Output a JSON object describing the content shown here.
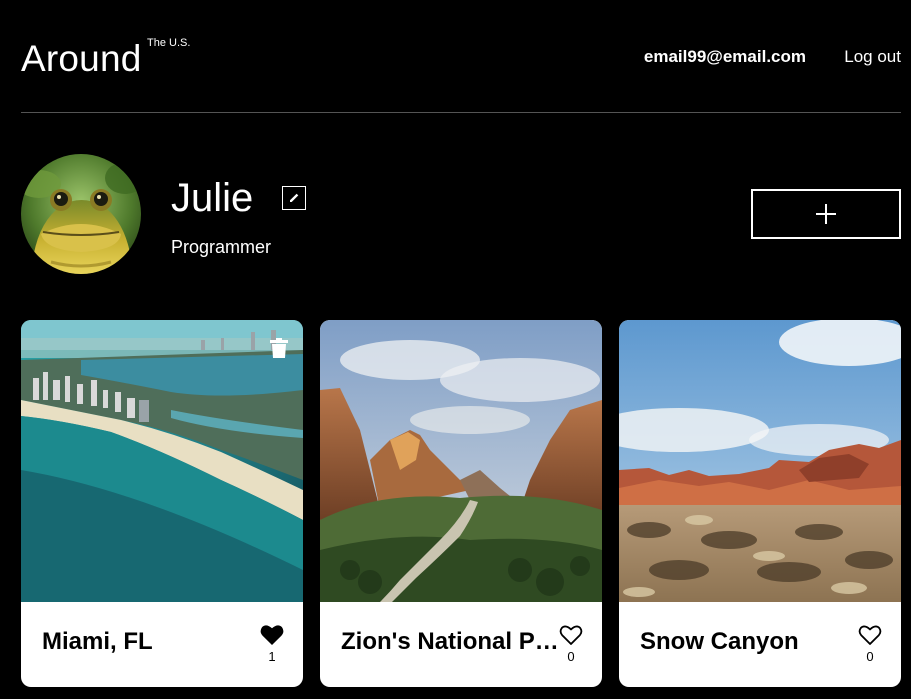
{
  "header": {
    "logo": "Around",
    "logo_sup": "The U.S.",
    "email": "email99@email.com",
    "logout_label": "Log out"
  },
  "profile": {
    "name": "Julie",
    "job": "Programmer",
    "avatar_icon": "frog-avatar",
    "edit_icon": "pencil-icon",
    "add_icon": "plus-icon"
  },
  "cards": [
    {
      "title": "Miami, FL",
      "likes": "1",
      "liked": true,
      "deletable": true,
      "image": "aerial-coastline-city"
    },
    {
      "title": "Zion's National Park",
      "likes": "0",
      "liked": false,
      "deletable": false,
      "image": "canyon-river-valley"
    },
    {
      "title": "Snow Canyon",
      "likes": "0",
      "liked": false,
      "deletable": false,
      "image": "desert-red-rocks"
    }
  ],
  "colors": {
    "background": "#000000",
    "card": "#ffffff",
    "divider": "#545454"
  }
}
